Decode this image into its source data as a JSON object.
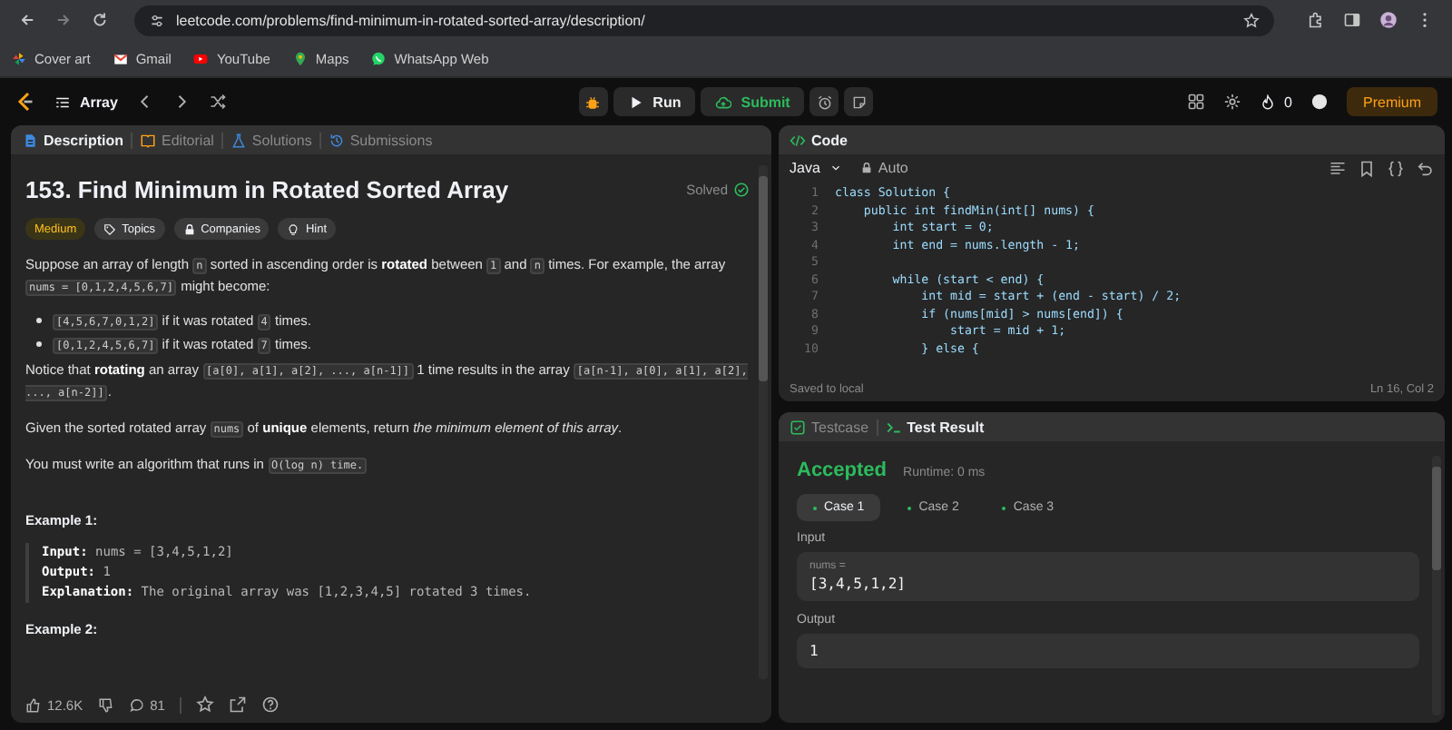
{
  "browser": {
    "url": "leetcode.com/problems/find-minimum-in-rotated-sorted-array/description/",
    "bookmarks": [
      {
        "label": "Cover art"
      },
      {
        "label": "Gmail"
      },
      {
        "label": "YouTube"
      },
      {
        "label": "Maps"
      },
      {
        "label": "WhatsApp Web"
      }
    ]
  },
  "navbar": {
    "problem_list": "Array",
    "run": "Run",
    "submit": "Submit",
    "streak": "0",
    "premium": "Premium"
  },
  "description_panel": {
    "tabs": [
      {
        "label": "Description",
        "selected": true
      },
      {
        "label": "Editorial",
        "selected": false
      },
      {
        "label": "Solutions",
        "selected": false
      },
      {
        "label": "Submissions",
        "selected": false
      }
    ],
    "title": "153. Find Minimum in Rotated Sorted Array",
    "status": "Solved",
    "tags": [
      {
        "label": "Medium",
        "kind": "difficulty"
      },
      {
        "label": "Topics",
        "kind": "topics"
      },
      {
        "label": "Companies",
        "kind": "companies"
      },
      {
        "label": "Hint",
        "kind": "hint"
      }
    ],
    "blocks": [
      {
        "kind": "paragraph",
        "segments": [
          {
            "text": "Suppose an array of length ",
            "kind": "plain"
          },
          {
            "text": "n",
            "kind": "code"
          },
          {
            "text": " sorted in ascending order is ",
            "kind": "plain"
          },
          {
            "text": "rotated",
            "kind": "bold"
          },
          {
            "text": " between ",
            "kind": "plain"
          },
          {
            "text": "1",
            "kind": "code"
          },
          {
            "text": " and ",
            "kind": "plain"
          },
          {
            "text": "n",
            "kind": "code"
          },
          {
            "text": " times. For example, the array ",
            "kind": "plain"
          },
          {
            "text": "nums = [0,1,2,4,5,6,7]",
            "kind": "code"
          },
          {
            "text": " might become:",
            "kind": "plain"
          }
        ]
      },
      {
        "kind": "bullet",
        "segments": [
          {
            "text": "[4,5,6,7,0,1,2]",
            "kind": "code"
          },
          {
            "text": " if it was rotated ",
            "kind": "plain"
          },
          {
            "text": "4",
            "kind": "code"
          },
          {
            "text": " times.",
            "kind": "plain"
          }
        ]
      },
      {
        "kind": "bullet",
        "segments": [
          {
            "text": "[0,1,2,4,5,6,7]",
            "kind": "code"
          },
          {
            "text": " if it was rotated ",
            "kind": "plain"
          },
          {
            "text": "7",
            "kind": "code"
          },
          {
            "text": " times.",
            "kind": "plain"
          }
        ]
      },
      {
        "kind": "paragraph",
        "segments": [
          {
            "text": "Notice that ",
            "kind": "plain"
          },
          {
            "text": "rotating",
            "kind": "bold"
          },
          {
            "text": " an array ",
            "kind": "plain"
          },
          {
            "text": "[a[0], a[1], a[2], ..., a[n-1]]",
            "kind": "code"
          },
          {
            "text": " 1 time results in the array ",
            "kind": "plain"
          },
          {
            "text": "[a[n-1], a[0], a[1], a[2], ..., a[n-2]]",
            "kind": "code"
          },
          {
            "text": ".",
            "kind": "plain"
          }
        ]
      },
      {
        "kind": "paragraph",
        "segments": [
          {
            "text": "Given the sorted rotated array ",
            "kind": "plain"
          },
          {
            "text": "nums",
            "kind": "code"
          },
          {
            "text": " of ",
            "kind": "plain"
          },
          {
            "text": "unique",
            "kind": "bold"
          },
          {
            "text": " elements, return ",
            "kind": "plain"
          },
          {
            "text": "the minimum element of this array",
            "kind": "italic"
          },
          {
            "text": ".",
            "kind": "plain"
          }
        ]
      },
      {
        "kind": "paragraph",
        "segments": [
          {
            "text": "You must write an algorithm that runs in ",
            "kind": "plain"
          },
          {
            "text": "O(log n) time.",
            "kind": "code"
          }
        ]
      },
      {
        "kind": "heading",
        "text": "Example 1:"
      },
      {
        "kind": "example",
        "lines": [
          {
            "label": "Input:",
            "value": "nums = [3,4,5,1,2]"
          },
          {
            "label": "Output:",
            "value": "1"
          },
          {
            "label": "Explanation:",
            "value": "The original array was [1,2,3,4,5] rotated 3 times."
          }
        ]
      },
      {
        "kind": "heading",
        "text": "Example 2:"
      }
    ],
    "footer": {
      "likes": "12.6K",
      "comments": "81"
    }
  },
  "code_panel": {
    "title": "Code",
    "language": "Java",
    "mode": "Auto",
    "lines": [
      {
        "number": "1",
        "code": "class Solution {"
      },
      {
        "number": "2",
        "code": "    public int findMin(int[] nums) {"
      },
      {
        "number": "3",
        "code": "        int start = 0;"
      },
      {
        "number": "4",
        "code": "        int end = nums.length - 1;"
      },
      {
        "number": "5"
      },
      {
        "number": "6",
        "code": "        while (start < end) {"
      },
      {
        "number": "7",
        "code": "            int mid = start + (end - start) / 2;"
      },
      {
        "number": "8",
        "code": "            if (nums[mid] > nums[end]) {"
      },
      {
        "number": "9",
        "code": "                start = mid + 1;"
      },
      {
        "number": "10",
        "code": "            } else {"
      }
    ],
    "status": "Saved to local",
    "cursor": "Ln 16, Col 2"
  },
  "result_panel": {
    "tabs": [
      {
        "label": "Testcase",
        "selected": false
      },
      {
        "label": "Test Result",
        "selected": true
      }
    ],
    "verdict": "Accepted",
    "runtime": "Runtime: 0 ms",
    "cases": [
      {
        "label": "Case 1",
        "selected": true
      },
      {
        "label": "Case 2",
        "selected": false
      },
      {
        "label": "Case 3",
        "selected": false
      }
    ],
    "input_label": "Input",
    "param_name": "nums =",
    "param_value": "[3,4,5,1,2]",
    "output_label": "Output",
    "output_value": "1"
  }
}
